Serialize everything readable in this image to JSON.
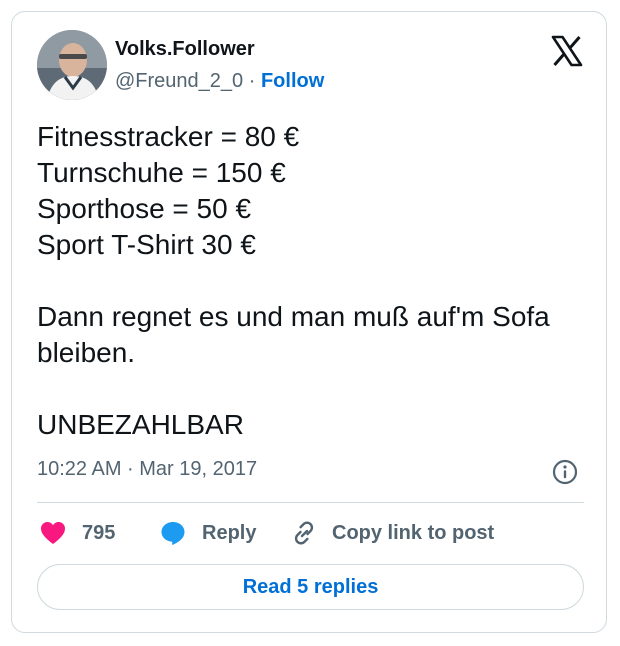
{
  "user": {
    "display_name": "Volks.Follower",
    "handle": "@Freund_2_0",
    "separator": "·",
    "follow_label": "Follow"
  },
  "tweet": {
    "lines": [
      "Fitnesstracker = 80 €",
      "Turnschuhe = 150 €",
      "Sporthose = 50 €",
      "Sport T-Shirt 30 €",
      "",
      "Dann regnet es und man muß auf'm Sofa bleiben.",
      "",
      "UNBEZAHLBAR"
    ],
    "timestamp": "10:22 AM · Mar 19, 2017"
  },
  "actions": {
    "like_count": "795",
    "reply_label": "Reply",
    "copy_link_label": "Copy link to post"
  },
  "read_replies_label": "Read 5 replies",
  "icons": {
    "brand": "x-logo-icon",
    "info": "info-icon",
    "like": "heart-icon",
    "reply": "speech-bubble-icon",
    "copy": "link-icon"
  },
  "colors": {
    "text": "#0f1419",
    "secondary": "#536471",
    "link": "#006fd6",
    "like": "#f91880",
    "reply_icon": "#1d9bf0",
    "border": "#cfd9de"
  }
}
